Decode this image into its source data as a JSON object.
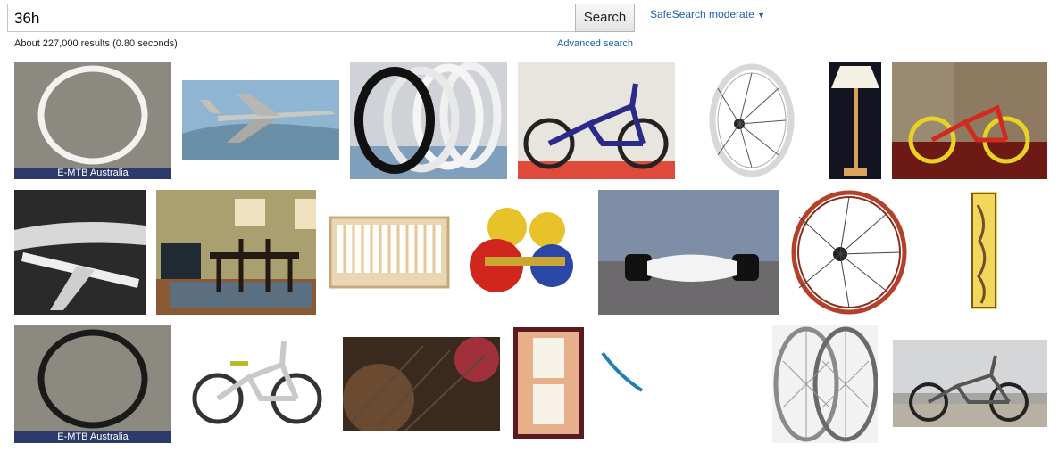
{
  "search": {
    "query": "36h",
    "button_label": "Search"
  },
  "safesearch": {
    "label": "SafeSearch moderate",
    "arrow": "▼"
  },
  "results": {
    "stats": "About 227,000 results (0.80 seconds)",
    "advanced_link": "Advanced search"
  },
  "images": [
    {
      "name": "white-rim",
      "caption": "E-MTB Australia"
    },
    {
      "name": "bomber-plane-color"
    },
    {
      "name": "tire-stack"
    },
    {
      "name": "blue-bmx-bike"
    },
    {
      "name": "white-wheel"
    },
    {
      "name": "floor-lamp"
    },
    {
      "name": "yellow-bmx-bike"
    },
    {
      "name": "bw-bomber-plane"
    },
    {
      "name": "dining-room"
    },
    {
      "name": "wooden-crib"
    },
    {
      "name": "colored-hubs"
    },
    {
      "name": "white-hub"
    },
    {
      "name": "red-wheel"
    },
    {
      "name": "stained-glass-panel"
    },
    {
      "name": "black-rim",
      "caption": "E-MTB Australia"
    },
    {
      "name": "silver-kids-bike"
    },
    {
      "name": "dark-spokes-photo"
    },
    {
      "name": "framed-notice-board"
    },
    {
      "name": "blue-rim-piece"
    },
    {
      "name": "blank-image"
    },
    {
      "name": "bw-wheels"
    },
    {
      "name": "bmx-on-deck"
    }
  ]
}
